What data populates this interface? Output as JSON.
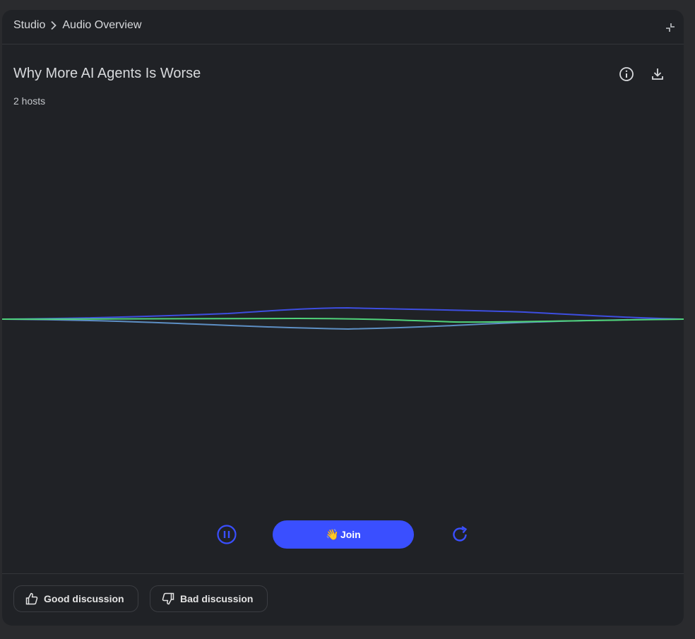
{
  "breadcrumb": {
    "root": "Studio",
    "current": "Audio Overview"
  },
  "overview": {
    "title": "Why More AI Agents Is Worse",
    "hosts": "2 hosts"
  },
  "controls": {
    "join_emoji": "👋",
    "join_label": "Join"
  },
  "feedback": {
    "good_label": "Good discussion",
    "bad_label": "Bad discussion"
  },
  "colors": {
    "accent": "#3a4fff",
    "wave_blue": "#3d4ee0",
    "wave_steel": "#5d8fc4",
    "wave_green": "#4fd27a"
  },
  "icons": {
    "breadcrumb_separator": "chevron-right-icon",
    "collapse": "collapse-icon",
    "info": "info-icon",
    "download": "download-icon",
    "pause": "pause-circle-icon",
    "replay": "replay-icon",
    "good": "thumb-up-icon",
    "bad": "thumb-down-icon"
  }
}
